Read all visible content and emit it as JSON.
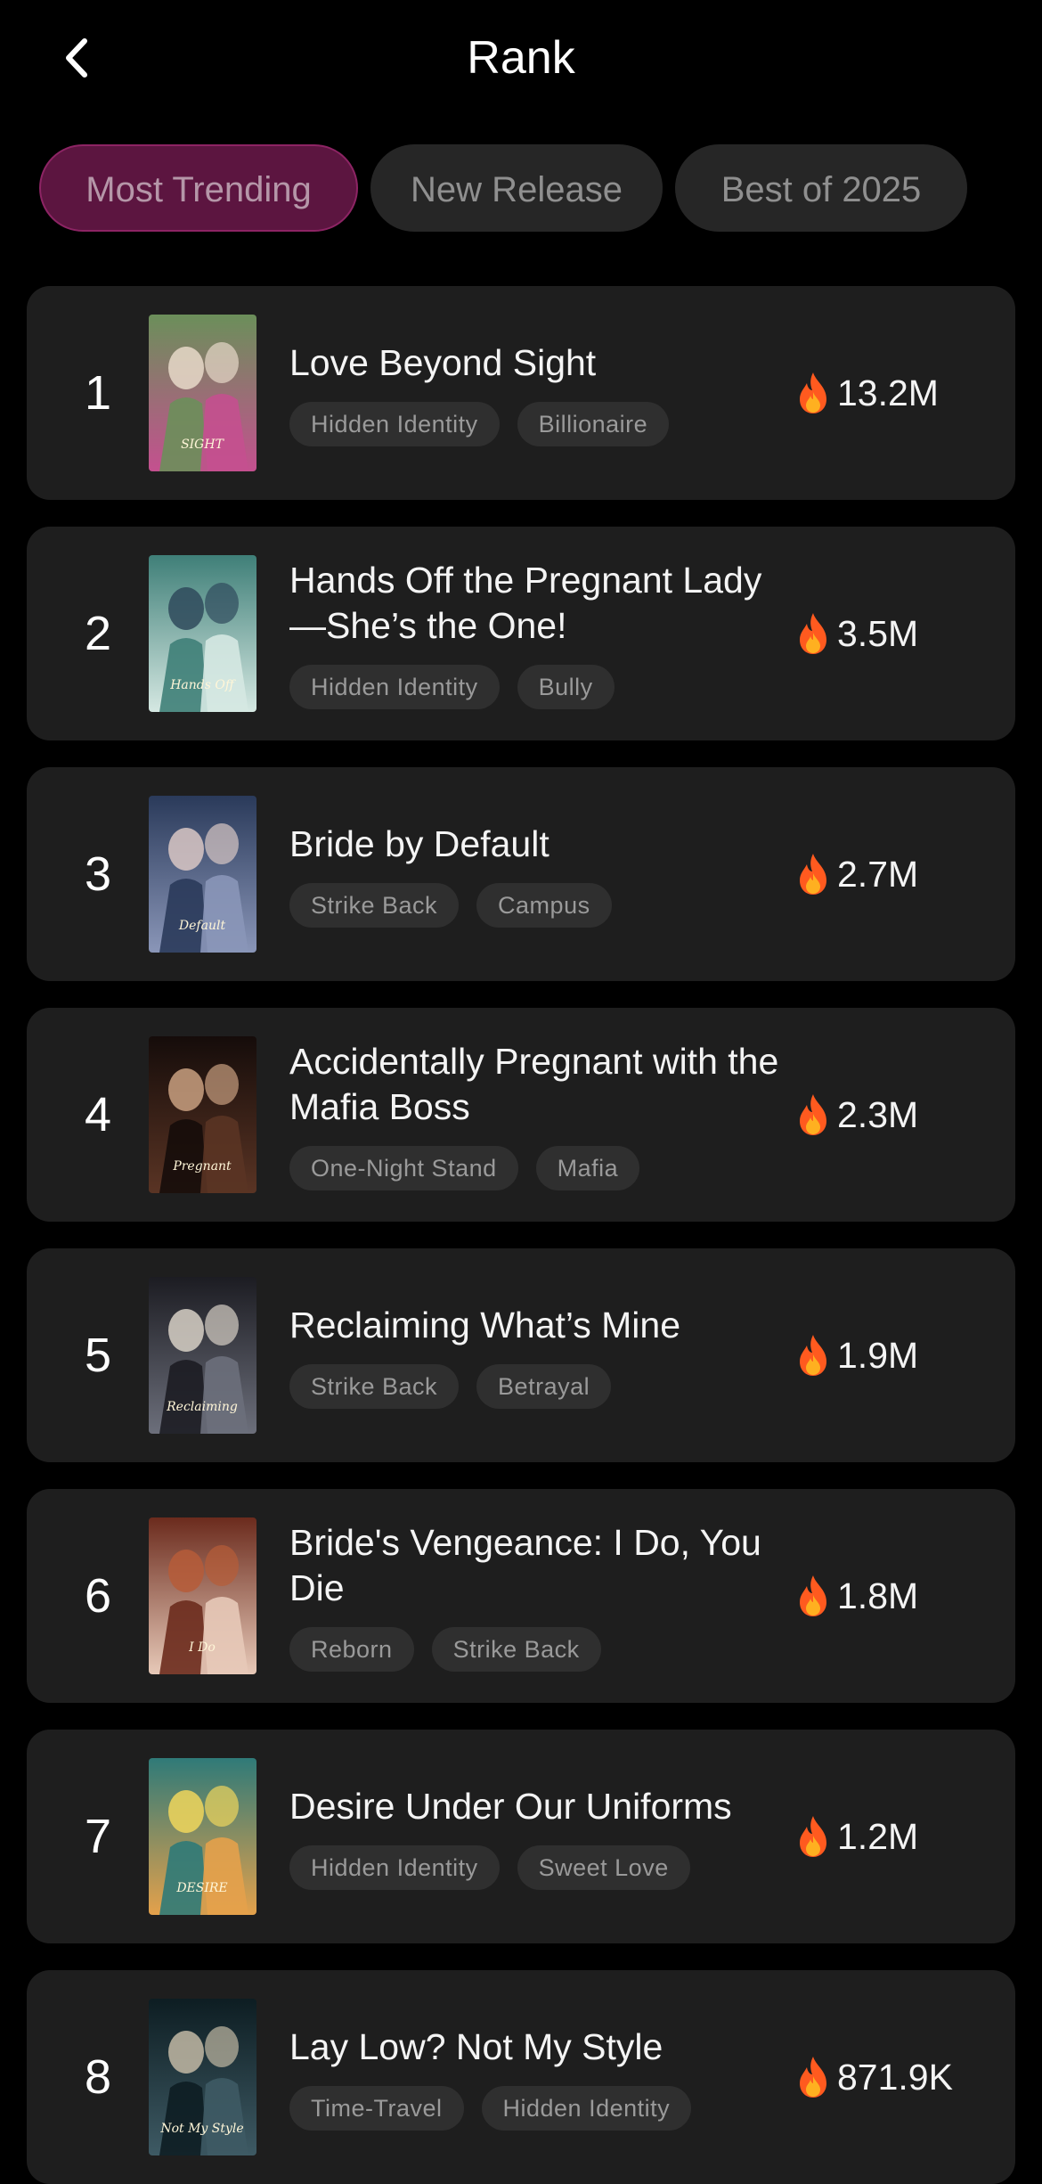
{
  "header": {
    "title": "Rank",
    "back_icon": "chevron-left-icon"
  },
  "tabs": [
    {
      "label": "Most Trending",
      "active": true
    },
    {
      "label": "New Release",
      "active": false
    },
    {
      "label": "Best of 2025",
      "active": false
    }
  ],
  "colors": {
    "accent": "#5c1540",
    "accent_border": "#8d2464",
    "card": "#1e1e1e",
    "fire": "#ff5a1f"
  },
  "items": [
    {
      "rank": "1",
      "title": "Love Beyond Sight",
      "tags": [
        "Hidden Identity",
        "Billionaire"
      ],
      "views": "13.2M",
      "cover_text": "SIGHT"
    },
    {
      "rank": "2",
      "title": "Hands Off the Pregnant Lady—She’s the One!",
      "tags": [
        "Hidden Identity",
        "Bully"
      ],
      "views": "3.5M",
      "cover_text": "Hands Off"
    },
    {
      "rank": "3",
      "title": "Bride by Default",
      "tags": [
        "Strike Back",
        "Campus"
      ],
      "views": "2.7M",
      "cover_text": "Default"
    },
    {
      "rank": "4",
      "title": "Accidentally Pregnant with the Mafia Boss",
      "tags": [
        "One-Night Stand",
        "Mafia"
      ],
      "views": "2.3M",
      "cover_text": "Pregnant"
    },
    {
      "rank": "5",
      "title": "Reclaiming What’s Mine",
      "tags": [
        "Strike Back",
        "Betrayal"
      ],
      "views": "1.9M",
      "cover_text": "Reclaiming"
    },
    {
      "rank": "6",
      "title": "Bride's Vengeance: I Do, You Die",
      "tags": [
        "Reborn",
        "Strike Back"
      ],
      "views": "1.8M",
      "cover_text": "I Do"
    },
    {
      "rank": "7",
      "title": "Desire Under Our Uniforms",
      "tags": [
        "Hidden Identity",
        "Sweet Love"
      ],
      "views": "1.2M",
      "cover_text": "DESIRE"
    },
    {
      "rank": "8",
      "title": "Lay Low? Not My Style",
      "tags": [
        "Time-Travel",
        "Hidden Identity"
      ],
      "views": "871.9K",
      "cover_text": "Not My Style"
    }
  ]
}
